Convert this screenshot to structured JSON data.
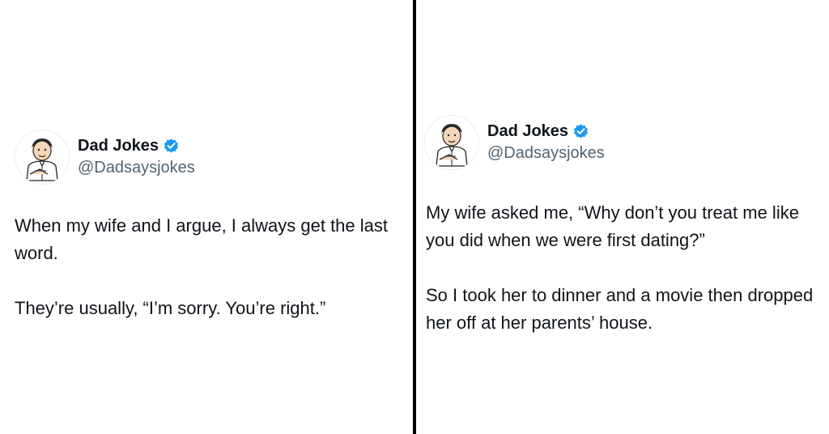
{
  "left_tweet": {
    "author": {
      "display_name": "Dad Jokes",
      "handle": "@Dadsaysjokes",
      "verified": true,
      "avatar_icon": "cartoon-man-avatar"
    },
    "paragraphs": [
      "When my wife and I argue, I always get the last word.",
      "They’re usually, “I’m sorry. You’re right.”"
    ]
  },
  "right_tweet": {
    "author": {
      "display_name": "Dad Jokes",
      "handle": "@Dadsaysjokes",
      "verified": true,
      "avatar_icon": "cartoon-man-avatar"
    },
    "paragraphs": [
      "My wife asked me, “Why don’t you treat me like you did when we were first dating?”",
      "So I took her to dinner and a movie then dropped her off at her parents’ house."
    ]
  },
  "colors": {
    "verified_badge": "#1d9bf0",
    "text_primary": "#0f1419",
    "text_secondary": "#536471",
    "divider": "#000000"
  }
}
